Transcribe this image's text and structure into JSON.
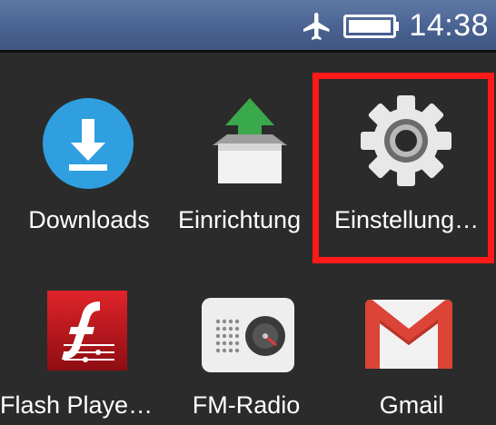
{
  "status_bar": {
    "time": "14:38",
    "airplane_icon": "airplane-mode-icon",
    "battery_icon": "battery-full-icon"
  },
  "apps": [
    {
      "label": "Downloads",
      "icon": "download-icon",
      "color": "#2f9fe0"
    },
    {
      "label": "Einrichtung",
      "icon": "setup-box-icon",
      "color": "#3aa94b"
    },
    {
      "label": "Einstellung…",
      "icon": "settings-gear-icon",
      "color": "#d9d9d9"
    },
    {
      "label": "Flash Playe…",
      "icon": "flash-player-icon",
      "color": "#c8161d"
    },
    {
      "label": "FM-Radio",
      "icon": "fm-radio-icon",
      "color": "#e6e6e6"
    },
    {
      "label": "Gmail",
      "icon": "gmail-icon",
      "color": "#db4437"
    }
  ],
  "highlight": {
    "color": "#ff1a1a",
    "target": "Einstellung…"
  }
}
